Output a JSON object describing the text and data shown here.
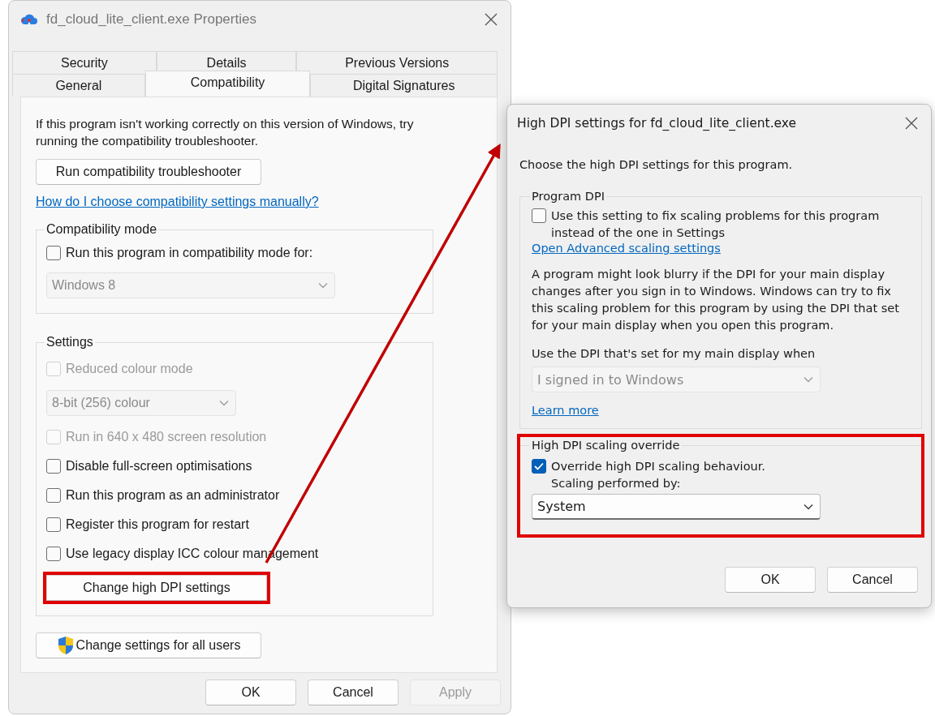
{
  "properties_window": {
    "title": "fd_cloud_lite_client.exe Properties",
    "tab_rows": [
      [
        {
          "label": "Security",
          "selected": false
        },
        {
          "label": "Details",
          "selected": false
        },
        {
          "label": "Previous Versions",
          "selected": false
        }
      ],
      [
        {
          "label": "General",
          "selected": false
        },
        {
          "label": "Compatibility",
          "selected": true
        },
        {
          "label": "Digital Signatures",
          "selected": false
        }
      ]
    ],
    "intro": "If this program isn't working correctly on this version of Windows, try running the compatibility troubleshooter.",
    "troubleshoot_button": "Run compatibility troubleshooter",
    "help_link": "How do I choose compatibility settings manually?",
    "compat_mode": {
      "label": "Compatibility mode",
      "checkbox": {
        "label": "Run this program in compatibility mode for:",
        "checked": false
      },
      "dropdown": {
        "value": "Windows 8",
        "disabled": true
      }
    },
    "settings": {
      "label": "Settings",
      "items": [
        {
          "kind": "checkbox",
          "label": "Reduced colour mode",
          "checked": false,
          "disabled": true
        },
        {
          "kind": "dropdown",
          "value": "8-bit (256) colour",
          "disabled": true
        },
        {
          "kind": "checkbox",
          "label": "Run in 640 x 480 screen resolution",
          "checked": false,
          "disabled": true
        },
        {
          "kind": "checkbox",
          "label": "Disable full-screen optimisations",
          "checked": false,
          "disabled": false
        },
        {
          "kind": "checkbox",
          "label": "Run this program as an administrator",
          "checked": false,
          "disabled": false
        },
        {
          "kind": "checkbox",
          "label": "Register this program for restart",
          "checked": false,
          "disabled": false
        },
        {
          "kind": "checkbox",
          "label": "Use legacy display ICC colour management",
          "checked": false,
          "disabled": false
        }
      ],
      "dpi_button": "Change high DPI settings"
    },
    "all_users_button": "Change settings for all users",
    "buttons": [
      {
        "label": "OK",
        "disabled": false
      },
      {
        "label": "Cancel",
        "disabled": false
      },
      {
        "label": "Apply",
        "disabled": true
      }
    ]
  },
  "dpi_dialog": {
    "title": "High DPI settings for fd_cloud_lite_client.exe",
    "intro": "Choose the high DPI settings for this program.",
    "program_dpi": {
      "label": "Program DPI",
      "checkbox": {
        "label": "Use this setting to fix scaling problems for this program instead of the one in Settings",
        "checked": false
      },
      "link": "Open Advanced scaling settings",
      "description": "A program might look blurry if the DPI for your main display changes after you sign in to Windows. Windows can try to fix this scaling problem for this program by using the DPI that set for your main display when you open this program.",
      "when_label": "Use the DPI that's set for my main display when",
      "dropdown": {
        "value": "I signed in to Windows",
        "disabled": true
      },
      "learn_more": "Learn more"
    },
    "override": {
      "label": "High DPI scaling override",
      "checkbox": {
        "label": "Override high DPI scaling behaviour.",
        "checked": true
      },
      "scaling_label": "Scaling performed by:",
      "dropdown": {
        "value": "System",
        "disabled": false
      }
    },
    "buttons": [
      {
        "label": "OK",
        "disabled": false
      },
      {
        "label": "Cancel",
        "disabled": false
      }
    ]
  }
}
